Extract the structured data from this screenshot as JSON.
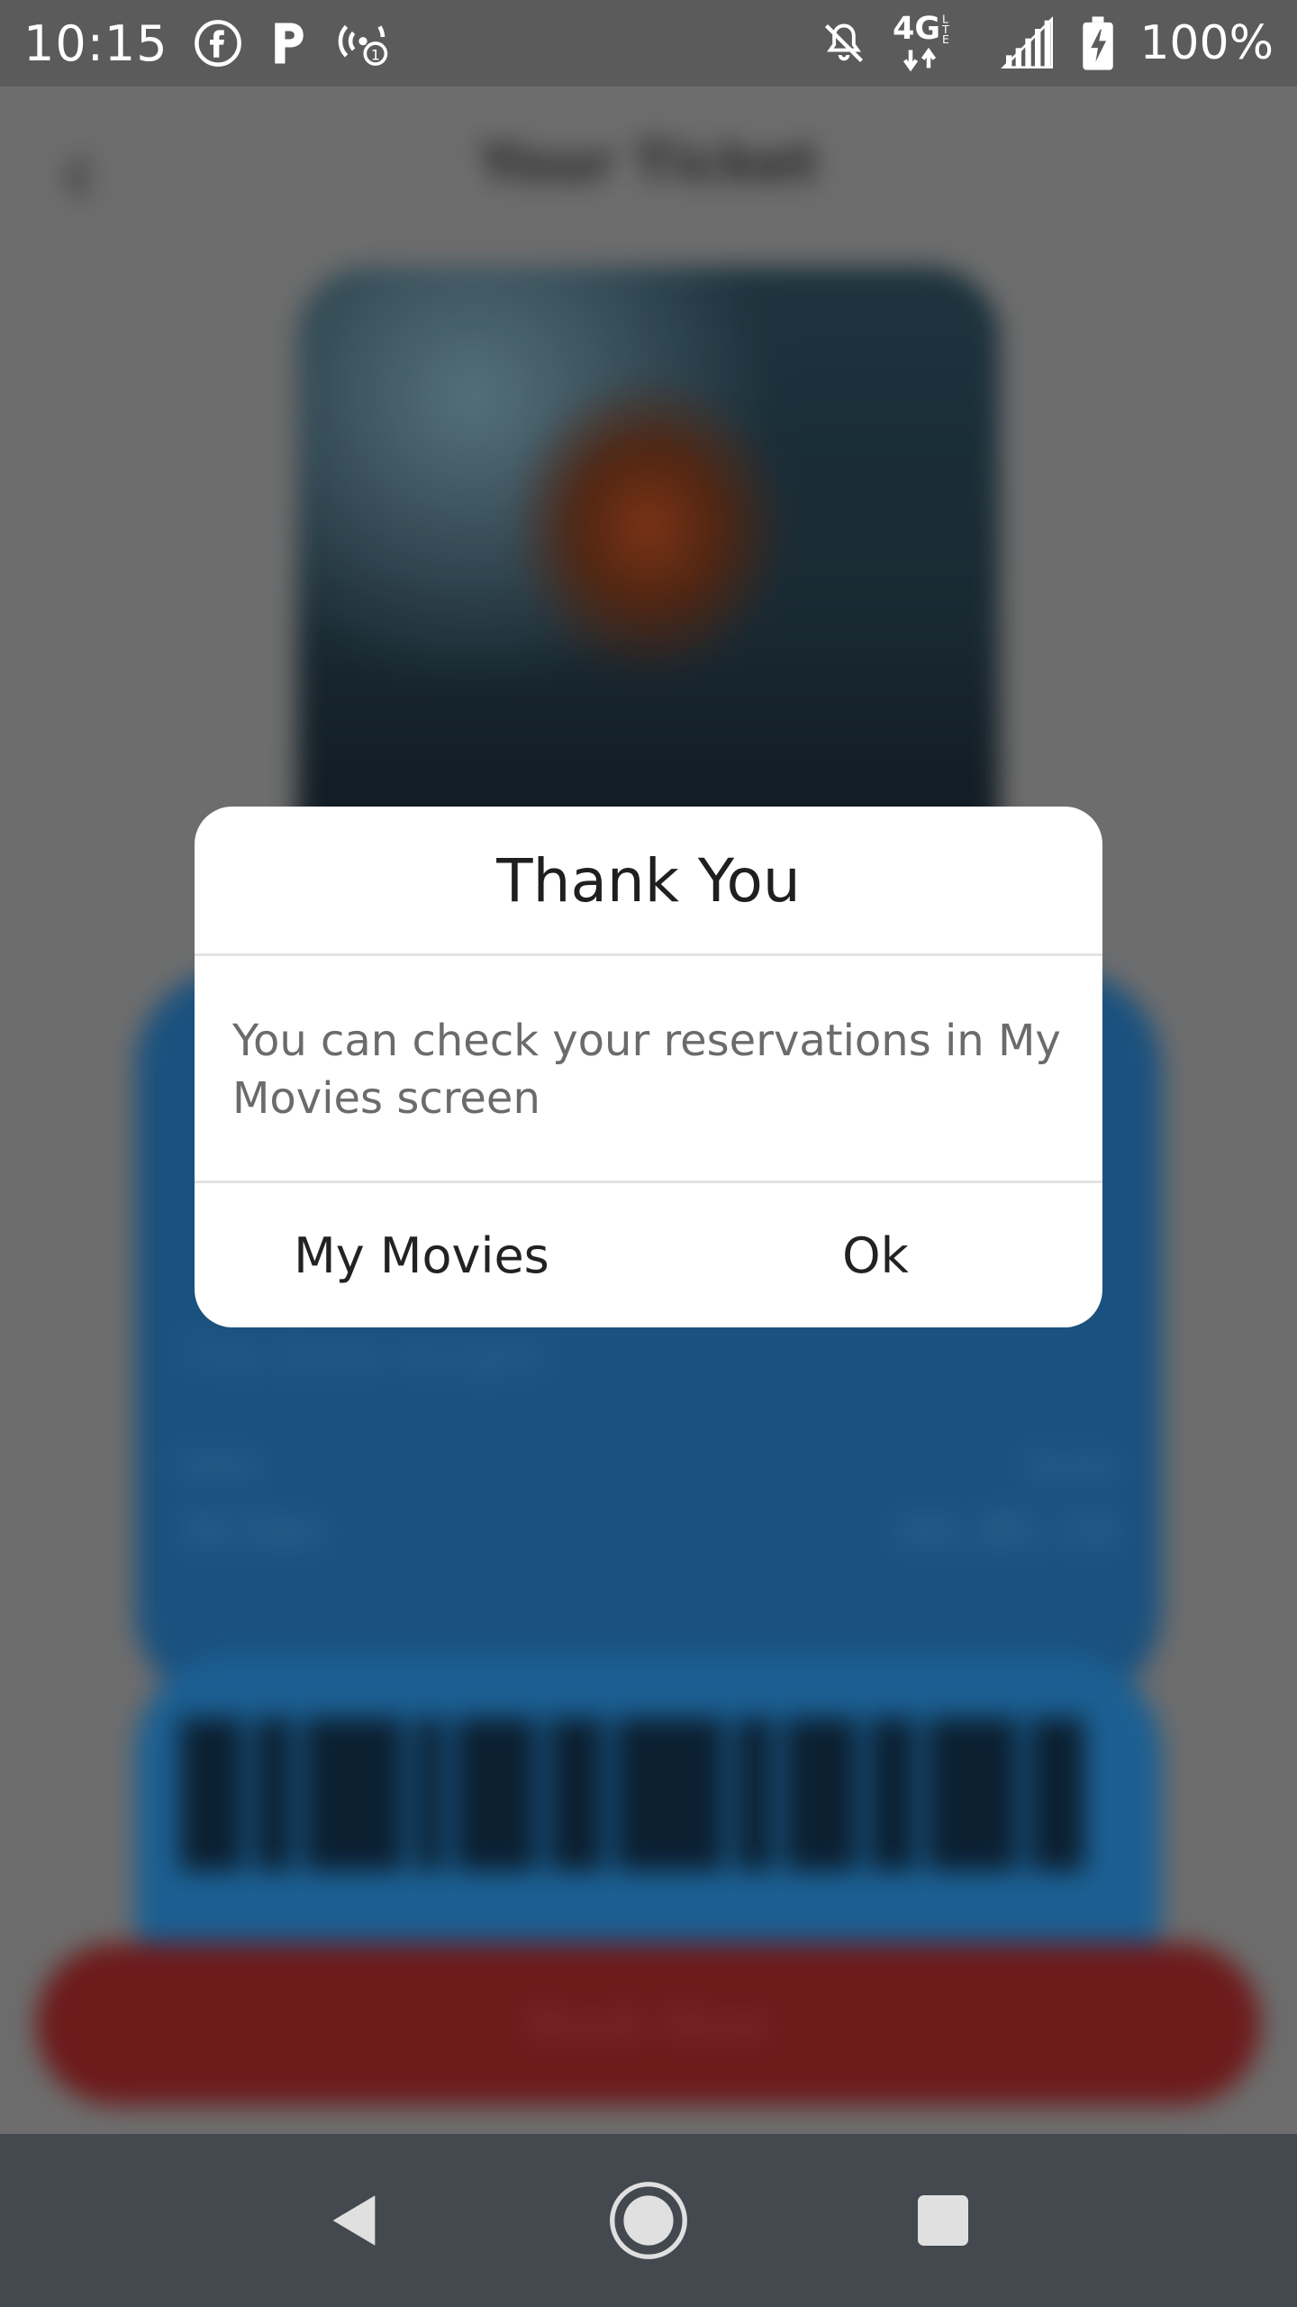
{
  "status_bar": {
    "time": "10:15",
    "battery": "100%",
    "left_icons": [
      "facebook-icon",
      "parking-icon",
      "hotspot-icon"
    ],
    "right_icons": [
      "do-not-disturb-bell-icon",
      "4g-lte-icon",
      "signal-icon",
      "battery-charging-icon"
    ]
  },
  "background_screen": {
    "title": "Your Ticket",
    "back_icon": "back-arrow-icon",
    "movie_name": "The Dark Knight",
    "rows": [
      {
        "label": "Date",
        "value": "30 Dec"
      },
      {
        "label": "Seats",
        "value": "A4, B5, C6"
      }
    ],
    "book_button": "Book Now"
  },
  "dialog": {
    "title": "Thank You",
    "message": "You can check your reservations in My Movies screen",
    "buttons": {
      "my_movies": "My Movies",
      "ok": "Ok"
    }
  },
  "navigation": {
    "back": "back-triangle-icon",
    "home": "home-circle-icon",
    "recents": "recents-square-icon"
  },
  "colors": {
    "status_bar": "#5b5b5b",
    "nav_bar": "#43494f",
    "ticket_blue": "#1e5b8d",
    "book_red": "#7a1e1f",
    "dialog_bg": "#ffffff"
  }
}
